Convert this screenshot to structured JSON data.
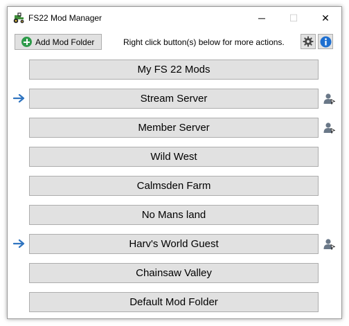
{
  "window": {
    "title": "FS22 Mod Manager",
    "controls": {
      "minimize": "─",
      "maximize": "☐",
      "close": "✕"
    }
  },
  "toolbar": {
    "add_folder_label": "Add Mod Folder",
    "hint": "Right click button(s) below for more actions.",
    "icons": [
      "gear-icon",
      "info-icon"
    ]
  },
  "folders": [
    {
      "label": "My FS 22 Mods",
      "active": false,
      "user": false
    },
    {
      "label": "Stream Server",
      "active": true,
      "user": true
    },
    {
      "label": "Member Server",
      "active": false,
      "user": true
    },
    {
      "label": "Wild West",
      "active": false,
      "user": false
    },
    {
      "label": "Calmsden Farm",
      "active": false,
      "user": false
    },
    {
      "label": "No Mans land",
      "active": false,
      "user": false
    },
    {
      "label": "Harv's World Guest",
      "active": true,
      "user": true
    },
    {
      "label": "Chainsaw Valley",
      "active": false,
      "user": false
    },
    {
      "label": "Default Mod Folder",
      "active": false,
      "user": false
    }
  ],
  "colors": {
    "arrow": "#2f74c0",
    "accent_green": "#2e9b4a",
    "button_face": "#e1e1e1",
    "info": "#1e6fd0"
  }
}
